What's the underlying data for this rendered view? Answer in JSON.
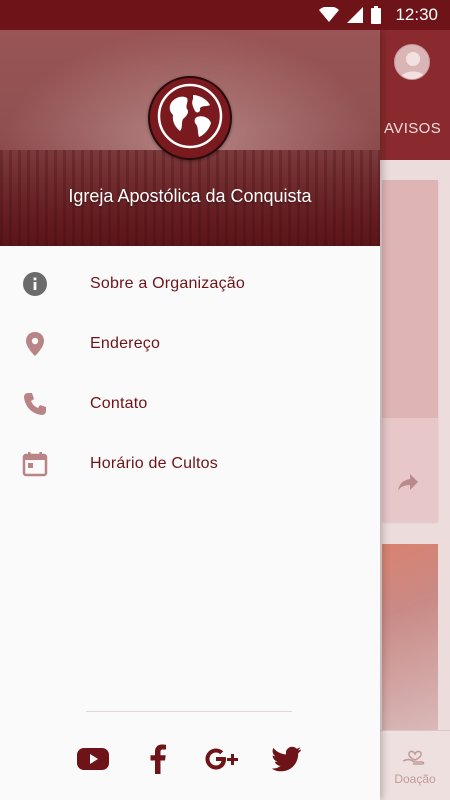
{
  "status_bar": {
    "time": "12:30"
  },
  "background_app": {
    "tab_label": "AVISOS",
    "bottom_nav_label": "Doação"
  },
  "drawer": {
    "organization_name": "Igreja Apostólica da Conquista",
    "menu": [
      {
        "label": "Sobre a Organização",
        "icon": "info-icon"
      },
      {
        "label": "Endereço",
        "icon": "location-pin-icon"
      },
      {
        "label": "Contato",
        "icon": "phone-icon"
      },
      {
        "label": "Horário de Cultos",
        "icon": "calendar-icon"
      }
    ],
    "social": [
      {
        "icon": "youtube-icon"
      },
      {
        "icon": "facebook-icon"
      },
      {
        "icon": "google-plus-icon"
      },
      {
        "icon": "twitter-icon"
      }
    ]
  },
  "colors": {
    "primary": "#6e1418",
    "menu_icon": "#9a6a6c",
    "drawer_bg": "#fafafa"
  }
}
